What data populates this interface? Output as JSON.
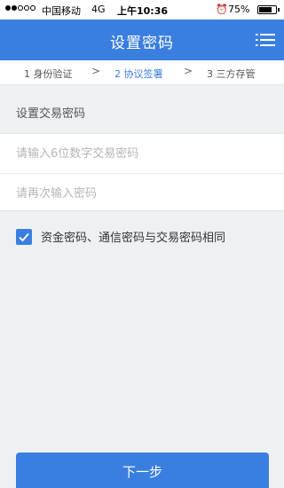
{
  "statusbar": {
    "carrier": "中国移动",
    "network": "4G",
    "time": "上午10:36",
    "battery": "75%",
    "battery_level": 0.75,
    "alarm_icon": "alarm-clock-icon"
  },
  "header": {
    "title": "设置密码",
    "menu_icon": "list-menu-icon"
  },
  "steps": [
    {
      "label": "1 身份验证",
      "active": false
    },
    {
      "label": "2 协议签署",
      "active": true
    },
    {
      "label": "3 三方存管",
      "active": false
    }
  ],
  "form": {
    "section_label": "设置交易密码",
    "password_placeholder": "请输入6位数字交易密码",
    "password_value": "",
    "confirm_placeholder": "请再次输入密码",
    "confirm_value": "",
    "agree_label": "资金密码、通信密码与交易密码相同",
    "agree_checked": true
  },
  "footer": {
    "next_label": "下一步"
  },
  "colors": {
    "accent": "#3a7fe0",
    "background": "#eef0f4"
  }
}
